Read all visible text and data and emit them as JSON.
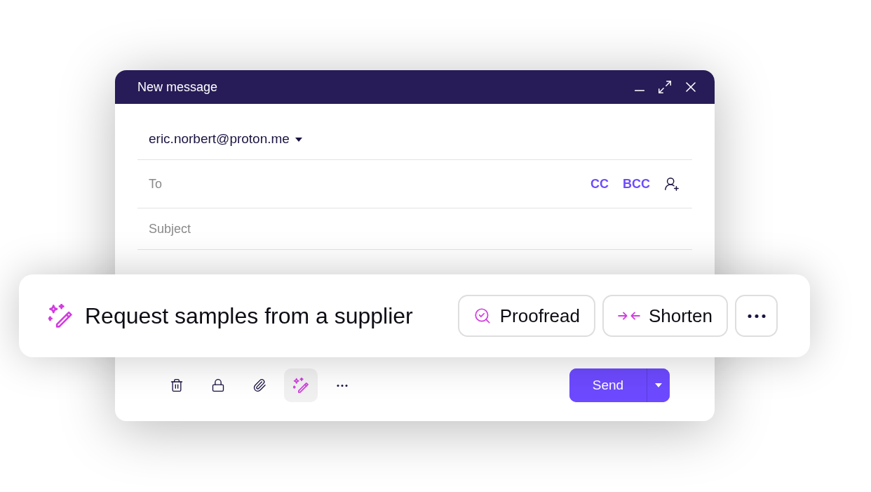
{
  "window": {
    "title": "New message"
  },
  "from": {
    "address": "eric.norbert@proton.me"
  },
  "to": {
    "placeholder": "To",
    "links": [
      "CC",
      "BCC"
    ]
  },
  "subject": {
    "placeholder": "Subject"
  },
  "toolbar": [
    {
      "kind": "delete",
      "active": false
    },
    {
      "kind": "lock",
      "active": false
    },
    {
      "kind": "attach",
      "active": false
    },
    {
      "kind": "assistant",
      "active": true
    },
    {
      "kind": "more",
      "active": false
    }
  ],
  "send_button": {
    "label": "Send"
  },
  "assistant_bar": {
    "prompt": "Request samples from a supplier",
    "actions": [
      {
        "kind": "proofread",
        "label": "Proofread"
      },
      {
        "kind": "shorten",
        "label": "Shorten"
      },
      {
        "kind": "more"
      }
    ]
  }
}
